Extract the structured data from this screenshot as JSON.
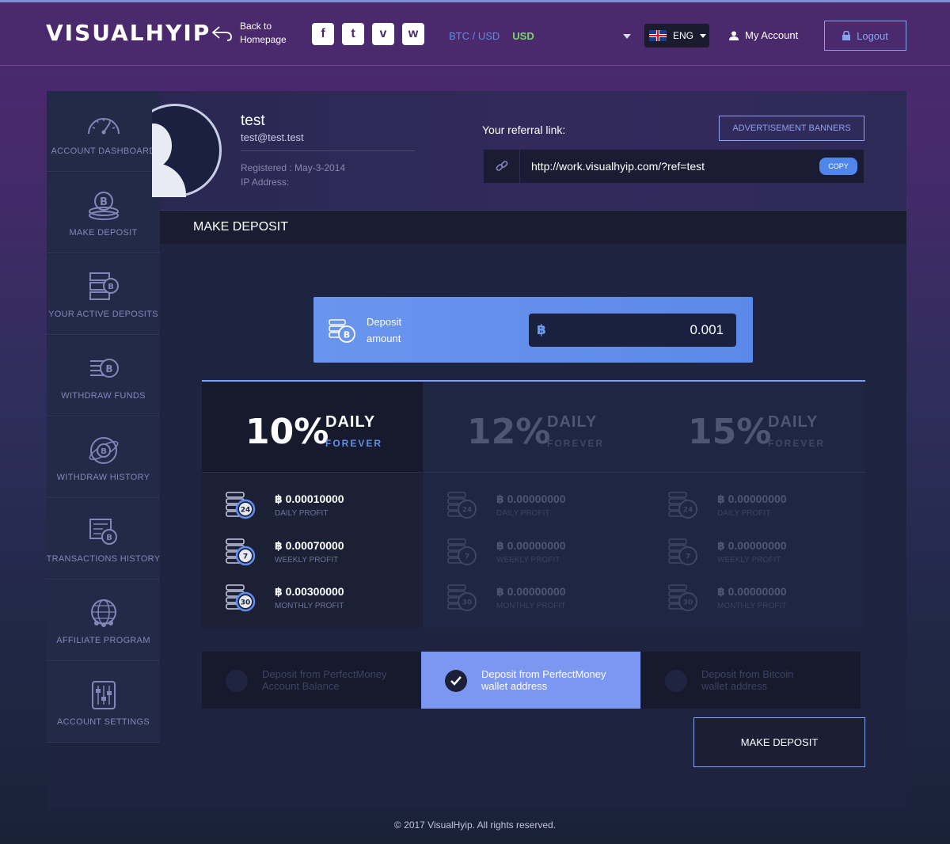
{
  "header": {
    "logo": "VISUALHYIP",
    "back_line1": "Back to",
    "back_line2": "Homepage",
    "socials": [
      {
        "icon": "facebook-icon",
        "glyph": "f"
      },
      {
        "icon": "twitter-icon",
        "glyph": "t"
      },
      {
        "icon": "vimeo-icon",
        "glyph": "v"
      },
      {
        "icon": "weibo-icon",
        "glyph": "w"
      }
    ],
    "currency_btc": "BTC / USD",
    "currency_usd": "USD",
    "language": "ENG",
    "my_account": "My Account",
    "logout": "Logout"
  },
  "sidebar": {
    "items": [
      {
        "label": "ACCOUNT DASHBOARD",
        "icon": "speedometer-icon"
      },
      {
        "label": "MAKE DEPOSIT",
        "icon": "coin-stack-icon"
      },
      {
        "label": "YOUR ACTIVE DEPOSITS",
        "icon": "server-coin-icon"
      },
      {
        "label": "WITHDRAW FUNDS",
        "icon": "withdraw-coin-icon"
      },
      {
        "label": "WITHDRAW HISTORY",
        "icon": "globe-coin-icon"
      },
      {
        "label": "TRANSACTIONS HISTORY",
        "icon": "transactions-icon"
      },
      {
        "label": "AFFILIATE PROGRAM",
        "icon": "affiliate-globe-icon"
      },
      {
        "label": "ACCOUNT SETTINGS",
        "icon": "sliders-icon"
      }
    ]
  },
  "profile": {
    "name": "test",
    "email": "test@test.test",
    "registered": "Registered : May-3-2014",
    "ip": "IP Address:",
    "referral_label": "Your referral link:",
    "referral_url": "http://work.visualhyip.com/?ref=test",
    "copy": "COPY",
    "adv_banners": "ADVERTISEMENT BANNERS"
  },
  "section": {
    "title": "MAKE DEPOSIT"
  },
  "deposit": {
    "label_line1": "Deposit",
    "label_line2": "amount",
    "currency_symbol": "฿",
    "amount": "0.001"
  },
  "plans": [
    {
      "percent": "10%",
      "daily": "DAILY",
      "forever": "FOREVER",
      "active": true,
      "rows": [
        {
          "badge": "24",
          "value": "฿ 0.00010000",
          "label": "DAILY PROFIT"
        },
        {
          "badge": "7",
          "value": "฿ 0.00070000",
          "label": "WEEKLY PROFIT"
        },
        {
          "badge": "30",
          "value": "฿ 0.00300000",
          "label": "MONTHLY PROFIT"
        }
      ]
    },
    {
      "percent": "12%",
      "daily": "DAILY",
      "forever": "FOREVER",
      "active": false,
      "rows": [
        {
          "badge": "24",
          "value": "฿ 0.00000000",
          "label": "DAILY PROFIT"
        },
        {
          "badge": "7",
          "value": "฿ 0.00000000",
          "label": "WEEKLY PROFIT"
        },
        {
          "badge": "30",
          "value": "฿ 0.00000000",
          "label": "MONTHLY PROFIT"
        }
      ]
    },
    {
      "percent": "15%",
      "daily": "DAILY",
      "forever": "FOREVER",
      "active": false,
      "rows": [
        {
          "badge": "24",
          "value": "฿ 0.00000000",
          "label": "DAILY PROFIT"
        },
        {
          "badge": "7",
          "value": "฿ 0.00000000",
          "label": "WEEKLY PROFIT"
        },
        {
          "badge": "30",
          "value": "฿ 0.00000000",
          "label": "MONTHLY PROFIT"
        }
      ]
    }
  ],
  "options": [
    {
      "line1": "Deposit from PerfectMoney",
      "line2": "Account Balance",
      "selected": false
    },
    {
      "line1": "Deposit from PerfectMoney",
      "line2": "wallet address",
      "selected": true
    },
    {
      "line1": "Deposit from Bitcoin",
      "line2": "wallet address",
      "selected": false
    }
  ],
  "make_deposit_button": "MAKE DEPOSIT",
  "footer": "© 2017 VisualHyip. All rights reserved."
}
